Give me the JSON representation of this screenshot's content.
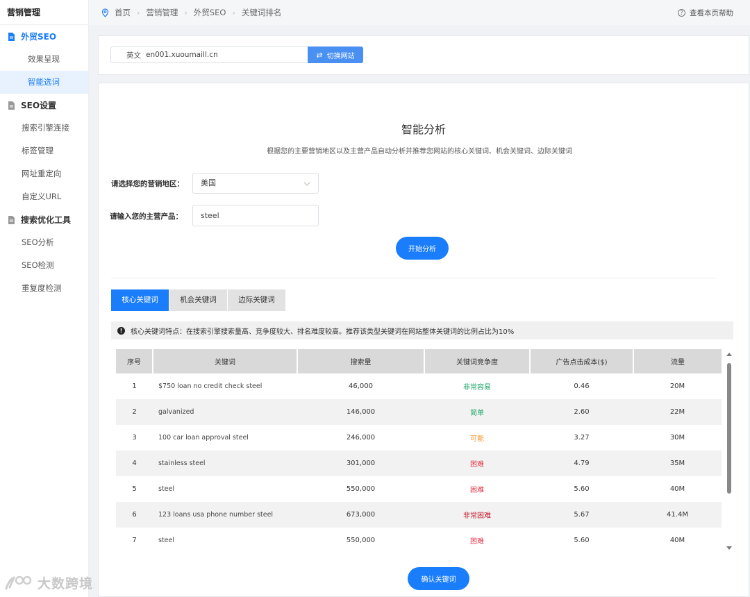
{
  "sidebar": {
    "title": "营销管理",
    "groups": [
      {
        "label": "外贸SEO",
        "items": [
          "效果呈现",
          "智能选词"
        ]
      },
      {
        "label": "SEO设置",
        "items": [
          "搜索引擎连接",
          "标签管理",
          "网址重定向",
          "自定义URL"
        ]
      },
      {
        "label": "搜索优化工具",
        "items": [
          "SEO分析",
          "SEO检测",
          "重复度检测"
        ]
      }
    ],
    "active_item": "智能选词"
  },
  "header": {
    "breadcrumb": [
      "首页",
      "营销管理",
      "外贸SEO",
      "关键词排名"
    ],
    "help": "查看本页帮助"
  },
  "site": {
    "lang": "英文",
    "domain": "en001.xuoumaill.cn",
    "switch_label": "切换网站"
  },
  "analysis": {
    "title": "智能分析",
    "desc": "根据您的主要营销地区以及主营产品自动分析并推荐您网站的核心关键词、机会关键词、边际关键词",
    "region_label": "请选择您的营销地区：",
    "region_value": "美国",
    "product_label": "请输入您的主营产品：",
    "product_value": "steel",
    "start_label": "开始分析"
  },
  "tabs": [
    "核心关键词",
    "机会关键词",
    "边际关键词"
  ],
  "info": "核心关键词特点：在搜索引擎搜索量高、竞争度较大、排名难度较高。推荐该类型关键词在网站整体关键词的比例占比为10%",
  "table": {
    "headers": [
      "序号",
      "关键词",
      "搜索量",
      "关键词竞争度",
      "广告点击成本($)",
      "流量"
    ],
    "rows": [
      [
        "1",
        "$750 loan no credit check steel",
        "46,000",
        "非常容易",
        "0.46",
        "20M"
      ],
      [
        "2",
        "galvanized",
        "146,000",
        "简单",
        "2.60",
        "22M"
      ],
      [
        "3",
        "100 car loan approval steel",
        "246,000",
        "可能",
        "3.27",
        "30M"
      ],
      [
        "4",
        "stainless steel",
        "301,000",
        "困难",
        "4.79",
        "35M"
      ],
      [
        "5",
        "steel",
        "550,000",
        "困难",
        "5.60",
        "40M"
      ],
      [
        "6",
        "123 loans usa phone number steel",
        "673,000",
        "非常困难",
        "5.67",
        "41.4M"
      ],
      [
        "7",
        "steel",
        "550,000",
        "困难",
        "5.60",
        "40M"
      ]
    ]
  },
  "confirm_label": "确认关键词",
  "watermark": "大数跨境",
  "colors": {
    "accent": "#1a7dfb",
    "easy": "#1aa566",
    "maybe": "#f0962a",
    "hard": "#e0364a",
    "very_hard": "#c41d2e"
  }
}
